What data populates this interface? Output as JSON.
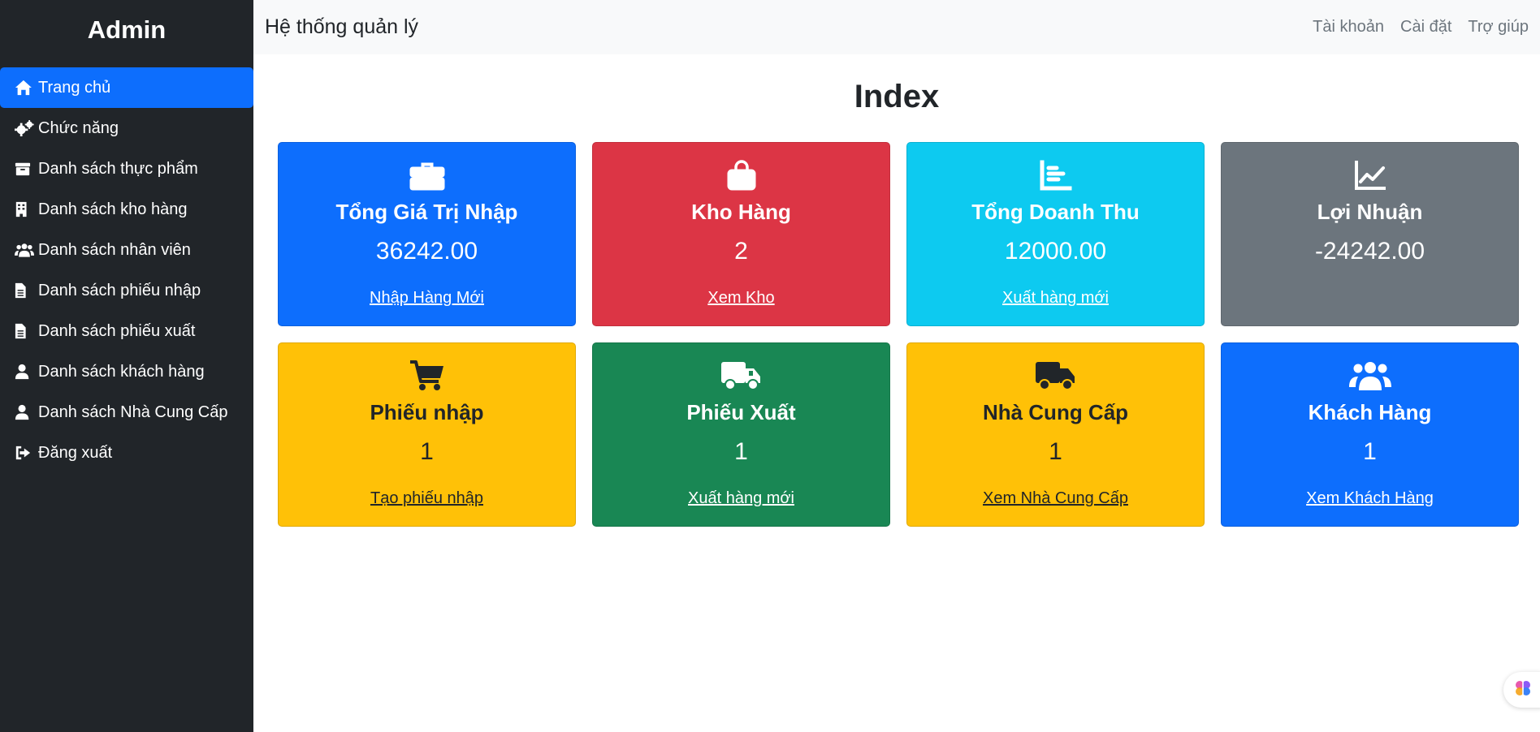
{
  "sidebar": {
    "brand": "Admin",
    "items": [
      {
        "label": "Trang chủ",
        "icon": "home-icon"
      },
      {
        "label": "Chức năng",
        "icon": "gears-icon"
      },
      {
        "label": "Danh sách thực phẩm",
        "icon": "box-icon"
      },
      {
        "label": "Danh sách kho hàng",
        "icon": "building-icon"
      },
      {
        "label": "Danh sách nhân viên",
        "icon": "users-icon"
      },
      {
        "label": "Danh sách phiếu nhập",
        "icon": "file-icon"
      },
      {
        "label": "Danh sách phiếu xuất",
        "icon": "file-icon"
      },
      {
        "label": "Danh sách khách hàng",
        "icon": "user-icon"
      },
      {
        "label": "Danh sách Nhà Cung Cấp",
        "icon": "user-icon"
      },
      {
        "label": "Đăng xuất",
        "icon": "sign-out-icon"
      }
    ]
  },
  "topbar": {
    "title": "Hệ thống quản lý",
    "links": [
      "Tài khoản",
      "Cài đặt",
      "Trợ giúp"
    ]
  },
  "main": {
    "title": "Index",
    "cards": [
      {
        "title": "Tổng Giá Trị Nhập",
        "value": "36242.00",
        "link": "Nhập Hàng Mới",
        "icon": "briefcase-icon",
        "color": "#0d6efd"
      },
      {
        "title": "Kho Hàng",
        "value": "2",
        "link": "Xem Kho",
        "icon": "shopping-bag-icon",
        "color": "#dc3545"
      },
      {
        "title": "Tổng Doanh Thu",
        "value": "12000.00",
        "link": "Xuất hàng mới",
        "icon": "bar-chart-icon",
        "color": "#0dcaf0"
      },
      {
        "title": "Lợi Nhuận",
        "value": "-24242.00",
        "link": "",
        "icon": "line-chart-icon",
        "color": "#6c757d"
      },
      {
        "title": "Phiếu nhập",
        "value": "1",
        "link": "Tạo phiếu nhập",
        "icon": "cart-icon",
        "color": "#ffc107"
      },
      {
        "title": "Phiếu Xuất",
        "value": "1",
        "link": "Xuất hàng mới",
        "icon": "shipping-truck-icon",
        "color": "#198754"
      },
      {
        "title": "Nhà Cung Cấp",
        "value": "1",
        "link": "Xem Nhà Cung Cấp",
        "icon": "truck-icon",
        "color": "#ffc107"
      },
      {
        "title": "Khách Hàng",
        "value": "1",
        "link": "Xem Khách Hàng",
        "icon": "users-icon",
        "color": "#0d6efd"
      }
    ]
  }
}
